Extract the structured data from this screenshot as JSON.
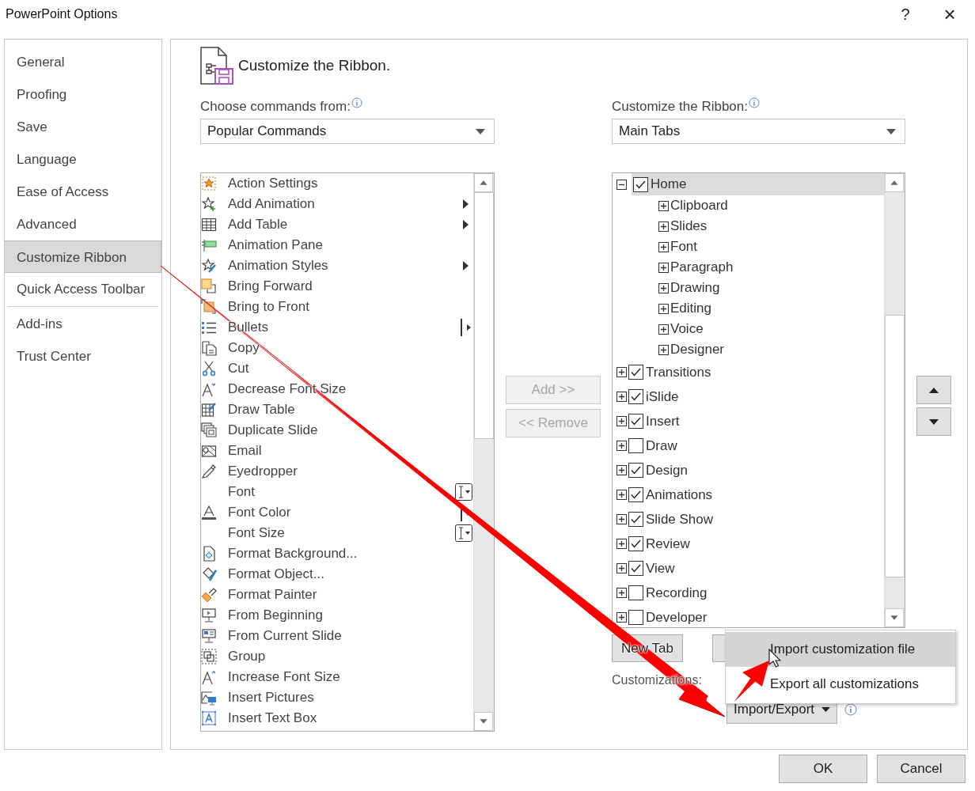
{
  "window": {
    "title": "PowerPoint Options",
    "help": "?",
    "close": "×"
  },
  "sidebar": {
    "items": [
      {
        "label": "General",
        "selected": false,
        "kind": "item"
      },
      {
        "label": "Proofing",
        "selected": false,
        "kind": "item"
      },
      {
        "label": "Save",
        "selected": false,
        "kind": "item"
      },
      {
        "label": "Language",
        "selected": false,
        "kind": "item"
      },
      {
        "label": "Ease of Access",
        "selected": false,
        "kind": "item"
      },
      {
        "label": "Advanced",
        "selected": false,
        "kind": "item"
      },
      {
        "label": "Customize Ribbon",
        "selected": true,
        "kind": "item"
      },
      {
        "label": "Quick Access Toolbar",
        "selected": false,
        "kind": "separator-after"
      },
      {
        "label": "Add-ins",
        "selected": false,
        "kind": "item"
      },
      {
        "label": "Trust Center",
        "selected": false,
        "kind": "item"
      }
    ]
  },
  "heading": "Customize the Ribbon.",
  "commands": {
    "label": "Choose commands from:",
    "dropdown": "Popular Commands",
    "items": [
      {
        "label": "Action Settings",
        "kind": "plain"
      },
      {
        "label": "Add Animation",
        "kind": "submenu"
      },
      {
        "label": "Add Table",
        "kind": "submenu"
      },
      {
        "label": "Animation Pane",
        "kind": "plain"
      },
      {
        "label": "Animation Styles",
        "kind": "submenu"
      },
      {
        "label": "Bring Forward",
        "kind": "plain"
      },
      {
        "label": "Bring to Front",
        "kind": "plain"
      },
      {
        "label": "Bullets",
        "kind": "split"
      },
      {
        "label": "Copy",
        "kind": "plain"
      },
      {
        "label": "Cut",
        "kind": "plain"
      },
      {
        "label": "Decrease Font Size",
        "kind": "plain"
      },
      {
        "label": "Draw Table",
        "kind": "plain"
      },
      {
        "label": "Duplicate Slide",
        "kind": "plain"
      },
      {
        "label": "Email",
        "kind": "plain"
      },
      {
        "label": "Eyedropper",
        "kind": "plain"
      },
      {
        "label": "Font",
        "kind": "combo"
      },
      {
        "label": "Font Color",
        "kind": "split"
      },
      {
        "label": "Font Size",
        "kind": "combo"
      },
      {
        "label": "Format Background...",
        "kind": "plain"
      },
      {
        "label": "Format Object...",
        "kind": "plain"
      },
      {
        "label": "Format Painter",
        "kind": "plain"
      },
      {
        "label": "From Beginning",
        "kind": "plain"
      },
      {
        "label": "From Current Slide",
        "kind": "plain"
      },
      {
        "label": "Group",
        "kind": "plain"
      },
      {
        "label": "Increase Font Size",
        "kind": "plain"
      },
      {
        "label": "Insert Pictures",
        "kind": "plain"
      },
      {
        "label": "Insert Text Box",
        "kind": "plain"
      }
    ]
  },
  "middle_buttons": [
    {
      "label": "Add >>",
      "disabled": true
    },
    {
      "label": "<< Remove",
      "disabled": true
    }
  ],
  "ribbon": {
    "label": "Customize the Ribbon:",
    "dropdown": "Main Tabs",
    "tabs": [
      {
        "label": "Home",
        "checked": true,
        "expanded": true,
        "selected": true,
        "children": [
          {
            "label": "Clipboard",
            "expanded": false
          },
          {
            "label": "Slides",
            "expanded": false
          },
          {
            "label": "Font",
            "expanded": false
          },
          {
            "label": "Paragraph",
            "expanded": false
          },
          {
            "label": "Drawing",
            "expanded": false
          },
          {
            "label": "Editing",
            "expanded": false
          },
          {
            "label": "Voice",
            "expanded": false
          },
          {
            "label": "Designer",
            "expanded": false
          }
        ]
      },
      {
        "label": "Transitions",
        "checked": true,
        "expanded": false,
        "selected": false
      },
      {
        "label": "iSlide",
        "checked": true,
        "expanded": false,
        "selected": false
      },
      {
        "label": "Insert",
        "checked": true,
        "expanded": false,
        "selected": false
      },
      {
        "label": "Draw",
        "checked": false,
        "expanded": false,
        "selected": false
      },
      {
        "label": "Design",
        "checked": true,
        "expanded": false,
        "selected": false
      },
      {
        "label": "Animations",
        "checked": true,
        "expanded": false,
        "selected": false
      },
      {
        "label": "Slide Show",
        "checked": true,
        "expanded": false,
        "selected": false
      },
      {
        "label": "Review",
        "checked": true,
        "expanded": false,
        "selected": false
      },
      {
        "label": "View",
        "checked": true,
        "expanded": false,
        "selected": false
      },
      {
        "label": "Recording",
        "checked": false,
        "expanded": false,
        "selected": false
      },
      {
        "label": "Developer",
        "checked": false,
        "expanded": false,
        "selected": false
      }
    ]
  },
  "new_tab_button": "New Tab",
  "customizations_label": "Customizations:",
  "import_export_button": "Import/Export",
  "menu": [
    {
      "label": "Import customization file",
      "selected": true
    },
    {
      "label": "Export all customizations",
      "selected": false
    }
  ],
  "footer_buttons": [
    "OK",
    "Cancel"
  ]
}
